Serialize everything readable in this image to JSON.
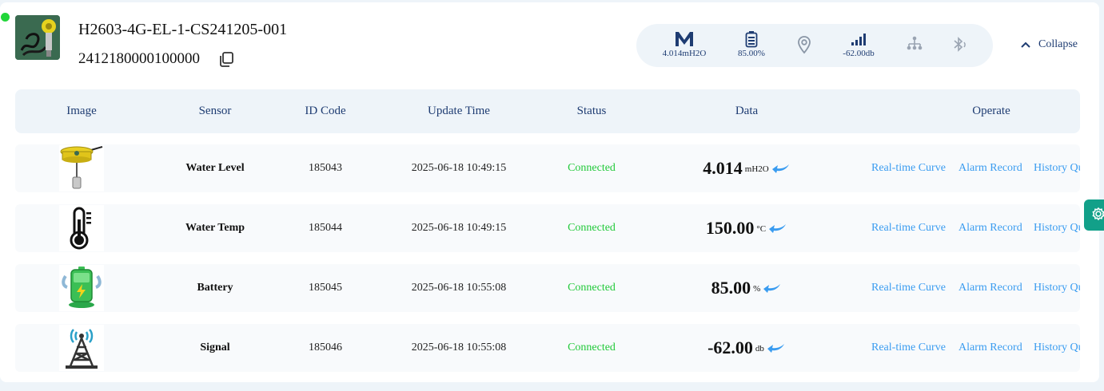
{
  "device": {
    "name": "H2603-4G-EL-1-CS241205-001",
    "imei": "2412180000100000"
  },
  "status_bar": {
    "items": [
      {
        "icon": "m-logo-icon",
        "value": "4.014mH2O"
      },
      {
        "icon": "battery-icon",
        "value": "85.00%"
      },
      {
        "icon": "location-pin-icon",
        "value": ""
      },
      {
        "icon": "signal-bars-icon",
        "value": "-62.00db"
      },
      {
        "icon": "network-tree-icon",
        "value": ""
      },
      {
        "icon": "bluetooth-icon",
        "value": ""
      }
    ],
    "collapse_label": "Collapse"
  },
  "table": {
    "headers": [
      "Image",
      "Sensor",
      "ID Code",
      "Update Time",
      "Status",
      "Data",
      "Operate"
    ],
    "rows": [
      {
        "image": "water-level-sensor-icon",
        "sensor": "Water Level",
        "id": "185043",
        "time": "2025-06-18 10:49:15",
        "status": "Connected",
        "value": "4.014",
        "unit": "mH2O"
      },
      {
        "image": "thermometer-icon",
        "sensor": "Water Temp",
        "id": "185044",
        "time": "2025-06-18 10:49:15",
        "status": "Connected",
        "value": "150.00",
        "unit": "°C"
      },
      {
        "image": "battery-charging-icon",
        "sensor": "Battery",
        "id": "185045",
        "time": "2025-06-18 10:55:08",
        "status": "Connected",
        "value": "85.00",
        "unit": "%"
      },
      {
        "image": "signal-tower-icon",
        "sensor": "Signal",
        "id": "185046",
        "time": "2025-06-18 10:55:08",
        "status": "Connected",
        "value": "-62.00",
        "unit": "db"
      }
    ],
    "operations": [
      "Real-time Curve",
      "Alarm Record",
      "History Qu"
    ]
  },
  "colors": {
    "accent": "#3a9cf0",
    "header_text": "#1e3c72",
    "connected": "#22c93a",
    "online": "#22d63a",
    "fab": "#12a089"
  }
}
